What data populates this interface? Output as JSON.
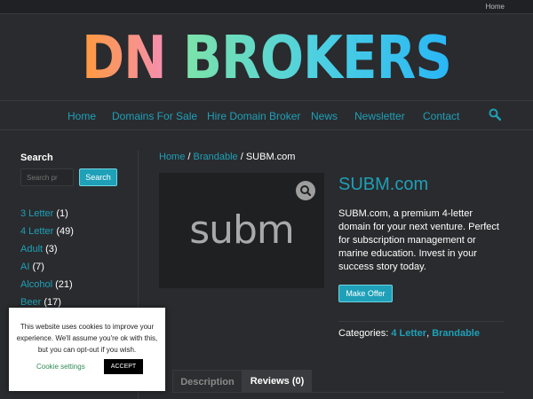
{
  "topbar": {
    "home_label": "Home"
  },
  "logo": {
    "part1": "DN",
    "part2": "BROKERS"
  },
  "nav": {
    "items": [
      "Home",
      "Domains For Sale",
      "Hire Domain Broker",
      "News",
      "Newsletter",
      "Contact"
    ],
    "accent": "#1ea0b8"
  },
  "sidebar": {
    "title": "Search",
    "search_placeholder": "Search pr",
    "search_button": "Search",
    "categories": [
      {
        "name": "3 Letter",
        "count": "(1)"
      },
      {
        "name": "4 Letter",
        "count": "(49)"
      },
      {
        "name": "Adult",
        "count": "(3)"
      },
      {
        "name": "AI",
        "count": "(7)"
      },
      {
        "name": "Alcohol",
        "count": "(21)"
      },
      {
        "name": "Beer",
        "count": "(17)"
      }
    ]
  },
  "breadcrumb": {
    "home": "Home",
    "sep1": " / ",
    "category": "Brandable",
    "sep2": " / ",
    "current": "SUBM.com"
  },
  "product": {
    "image_logo_text": "subm",
    "title": "SUBM.com",
    "description": "SUBM.com, a premium 4-letter domain for your next venture. Perfect for subscription management or marine education. Invest in your success story today.",
    "offer_button": "Make Offer",
    "categories_label": "Categories: ",
    "categories": [
      "4 Letter",
      "Brandable"
    ],
    "categories_sep": ", "
  },
  "tabs": [
    "Description",
    "Reviews (0)"
  ],
  "cookie": {
    "text": "This website uses cookies to improve your experience. We'll assume you're ok with this, but you can opt-out if you wish.",
    "settings_label": "Cookie settings",
    "accept_label": "ACCEPT"
  }
}
